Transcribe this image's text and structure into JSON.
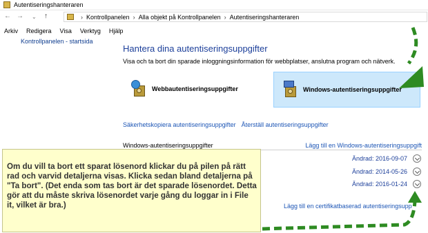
{
  "window": {
    "title": "Autentiseringshanteraren"
  },
  "addressbar": {
    "breadcrumbs": [
      "Kontrollpanelen",
      "Alla objekt på Kontrollpanelen",
      "Autentiseringshanteraren"
    ]
  },
  "menu": [
    "Arkiv",
    "Redigera",
    "Visa",
    "Verktyg",
    "Hjälp"
  ],
  "sidebar": {
    "home_link": "Kontrollpanelen - startsida"
  },
  "main": {
    "title": "Hantera dina autentiseringsuppgifter",
    "description": "Visa och ta bort din sparade inloggningsinformation för webbplatser, anslutna program och nätverk.",
    "web_credentials": "Webbautentiseringsuppgifter",
    "windows_credentials": "Windows-autentiseringsuppgifter",
    "backup_link": "Säkerhetskopiera autentiseringsuppgifter",
    "restore_link": "Återställ autentiseringsuppgifter",
    "section_title": "Windows-autentiseringsuppgifter",
    "add_windows_link": "Lägg till en Windows-autentiseringsuppgift",
    "rows": [
      {
        "modified": "Ändrad:  2016-09-07"
      },
      {
        "modified": "Ändrad:  2014-05-26"
      },
      {
        "modified": "Ändrad:  2016-01-24"
      }
    ],
    "add_cert_link": "Lägg till en certifikatbaserad autentiseringsupp"
  },
  "note": {
    "text": "Om du vill ta bort ett sparat lösenord klickar du på pilen på rätt rad och varvid detaljerna visas. Klicka sedan bland detaljerna på \"Ta bort\". (Det enda som tas bort är det sparade lösenordet. Detta gör att du måste skriva lösenordet varje gång du loggar in i File it, vilket är bra.)"
  },
  "colors": {
    "annotation_arrow": "#2e8b22",
    "note_background": "#ffffcc",
    "selected_tile": "#cde8fb"
  }
}
